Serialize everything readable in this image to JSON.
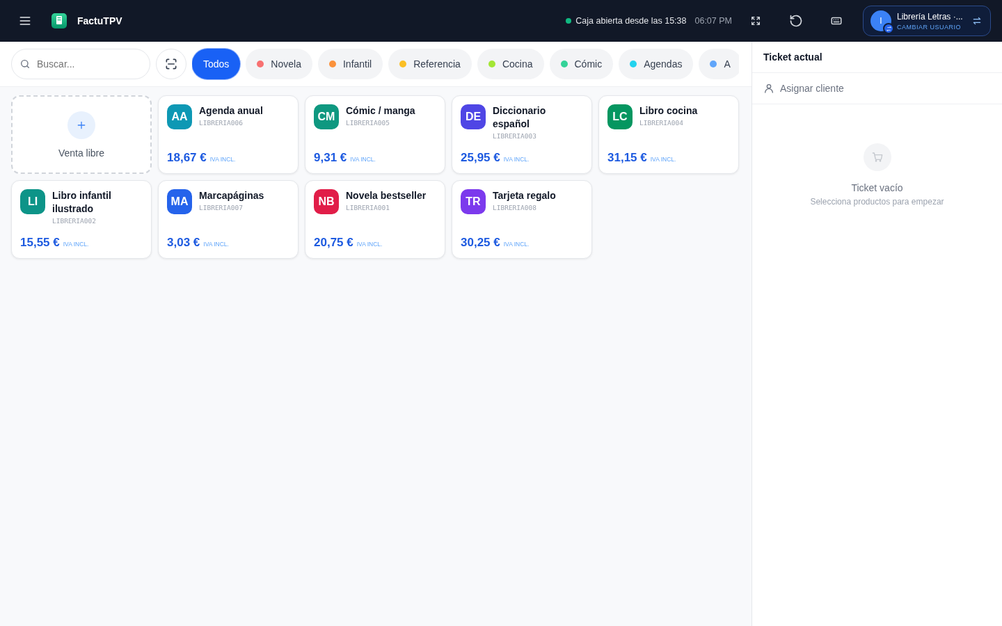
{
  "header": {
    "app_name": "FactuTPV",
    "status": "Caja abierta desde las 15:38",
    "time": "06:07 PM",
    "user": {
      "initial": "I",
      "name": "Librería Letras ·...",
      "action": "CAMBIAR USUARIO"
    }
  },
  "search": {
    "placeholder": "Buscar..."
  },
  "categories": [
    {
      "label": "Todos",
      "selected": true
    },
    {
      "label": "Novela",
      "color": "#f87171",
      "selected": false
    },
    {
      "label": "Infantil",
      "color": "#fb923c",
      "selected": false
    },
    {
      "label": "Referencia",
      "color": "#fbbf24",
      "selected": false
    },
    {
      "label": "Cocina",
      "color": "#a3e635",
      "selected": false
    },
    {
      "label": "Cómic",
      "color": "#34d399",
      "selected": false
    },
    {
      "label": "Agendas",
      "color": "#22d3ee",
      "selected": false
    },
    {
      "label": "A",
      "color": "#60a5fa",
      "selected": false
    }
  ],
  "products": [
    {
      "kind": "free",
      "name": "Venta libre"
    },
    {
      "kind": "product",
      "initials": "AA",
      "color": "#0e98b4",
      "name": "Agenda anual",
      "code": "LIBRERIA006",
      "price": "18,67 €",
      "tax": "IVA INCL."
    },
    {
      "kind": "product",
      "initials": "CM",
      "color": "#0f9880",
      "name": "Cómic / manga",
      "code": "LIBRERIA005",
      "price": "9,31 €",
      "tax": "IVA INCL."
    },
    {
      "kind": "product",
      "initials": "DE",
      "color": "#4f46e5",
      "name": "Diccionario español",
      "code": "LIBRERIA003",
      "price": "25,95 €",
      "tax": "IVA INCL."
    },
    {
      "kind": "product",
      "initials": "LC",
      "color": "#059660",
      "name": "Libro cocina",
      "code": "LIBRERIA004",
      "price": "31,15 €",
      "tax": "IVA INCL."
    },
    {
      "kind": "product",
      "initials": "LI",
      "color": "#0d9488",
      "name": "Libro infantil ilustrado",
      "code": "LIBRERIA002",
      "price": "15,55 €",
      "tax": "IVA INCL."
    },
    {
      "kind": "product",
      "initials": "MA",
      "color": "#2563eb",
      "name": "Marcapáginas",
      "code": "LIBRERIA007",
      "price": "3,03 €",
      "tax": "IVA INCL."
    },
    {
      "kind": "product",
      "initials": "NB",
      "color": "#e11d48",
      "name": "Novela bestseller",
      "code": "LIBRERIA001",
      "price": "20,75 €",
      "tax": "IVA INCL."
    },
    {
      "kind": "product",
      "initials": "TR",
      "color": "#7c3aed",
      "name": "Tarjeta regalo",
      "code": "LIBRERIA008",
      "price": "30,25 €",
      "tax": "IVA INCL."
    }
  ],
  "ticket": {
    "title": "Ticket actual",
    "assign_client": "Asignar cliente",
    "empty_title": "Ticket vacío",
    "empty_hint": "Selecciona productos para empezar"
  }
}
